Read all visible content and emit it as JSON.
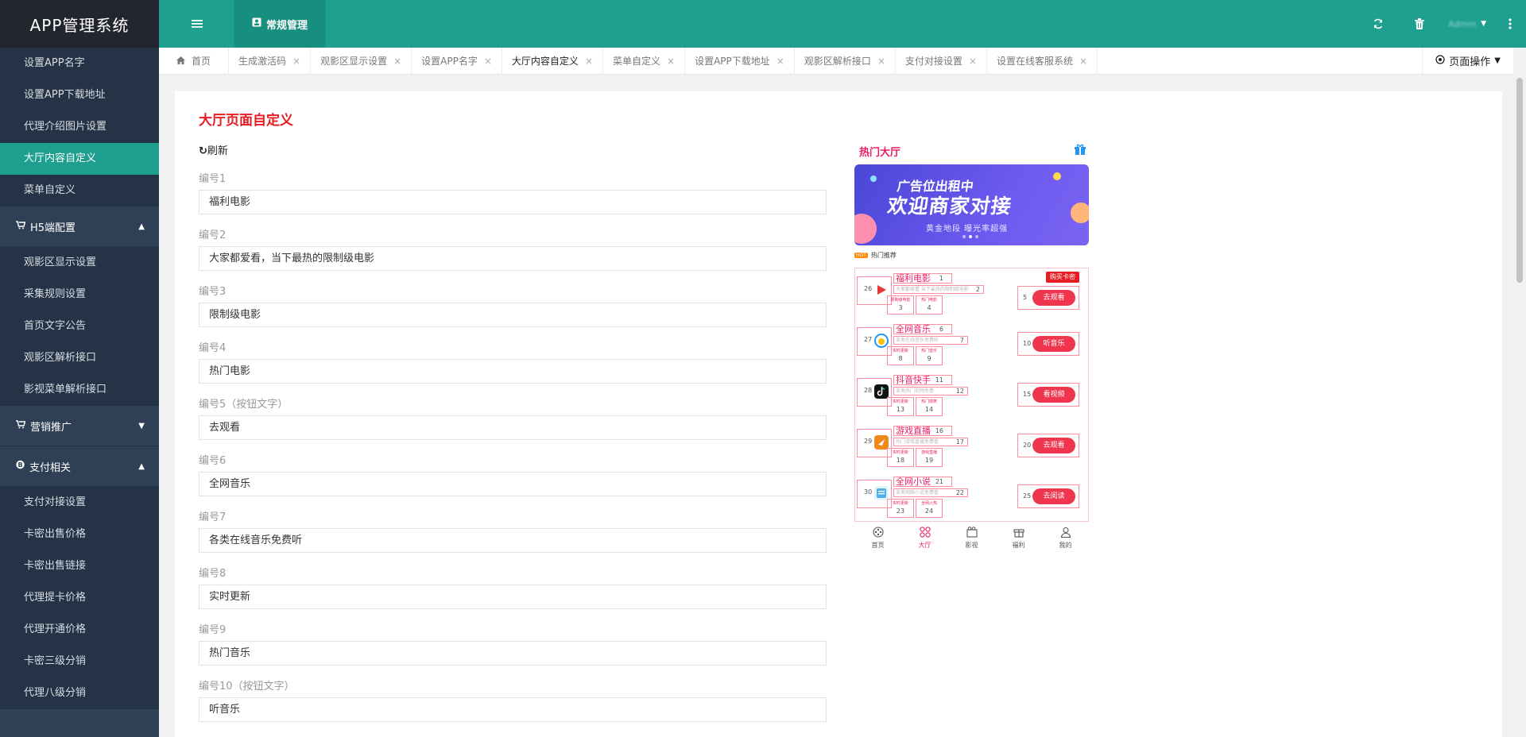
{
  "app": {
    "title": "APP管理系统"
  },
  "sidebar": {
    "items_top": [
      {
        "label": "设置APP名字"
      },
      {
        "label": "设置APP下载地址"
      },
      {
        "label": "代理介绍图片设置"
      },
      {
        "label": "大厅内容自定义",
        "active": true
      },
      {
        "label": "菜单自定义"
      }
    ],
    "group_h5": {
      "label": "H5端配置",
      "icon": "cart-icon"
    },
    "items_h5": [
      {
        "label": "观影区显示设置"
      },
      {
        "label": "采集规则设置"
      },
      {
        "label": "首页文字公告"
      },
      {
        "label": "观影区解析接口"
      },
      {
        "label": "影视菜单解析接口"
      }
    ],
    "group_marketing": {
      "label": "营销推广",
      "icon": "cart-icon"
    },
    "group_pay": {
      "label": "支付相关",
      "icon": "bitcoin-icon"
    },
    "items_pay": [
      {
        "label": "支付对接设置"
      },
      {
        "label": "卡密出售价格"
      },
      {
        "label": "卡密出售链接"
      },
      {
        "label": "代理提卡价格"
      },
      {
        "label": "代理开通价格"
      },
      {
        "label": "卡密三级分销"
      },
      {
        "label": "代理八级分销"
      }
    ]
  },
  "topbar": {
    "module_label": "常规管理",
    "user_name": "Admin"
  },
  "tabs": {
    "home": "首页",
    "items": [
      {
        "label": "生成激活码"
      },
      {
        "label": "观影区显示设置"
      },
      {
        "label": "设置APP名字"
      },
      {
        "label": "大厅内容自定义",
        "active": true
      },
      {
        "label": "菜单自定义"
      },
      {
        "label": "设置APP下载地址"
      },
      {
        "label": "观影区解析接口"
      },
      {
        "label": "支付对接设置"
      },
      {
        "label": "设置在线客服系统"
      }
    ],
    "ops_label": "页面操作"
  },
  "main": {
    "title": "大厅页面自定义",
    "refresh_label": "刷新",
    "fields": [
      {
        "label": "编号1",
        "value": "福利电影"
      },
      {
        "label": "编号2",
        "value": "大家都爱看，当下最热的限制级电影"
      },
      {
        "label": "编号3",
        "value": "限制级电影"
      },
      {
        "label": "编号4",
        "value": "热门电影"
      },
      {
        "label": "编号5（按钮文字）",
        "value": "去观看"
      },
      {
        "label": "编号6",
        "value": "全网音乐"
      },
      {
        "label": "编号7",
        "value": "各类在线音乐免费听"
      },
      {
        "label": "编号8",
        "value": "实时更新"
      },
      {
        "label": "编号9",
        "value": "热门音乐"
      },
      {
        "label": "编号10（按钮文字）",
        "value": "听音乐"
      }
    ]
  },
  "preview": {
    "title": "热门大厅",
    "banner_line1": "广告位出租中",
    "banner_line2": "欢迎商家对接",
    "banner_line3": "黄金地段    曝光率超强",
    "rec_badge": "HOT",
    "rec_label": "热门推荐",
    "buy_card": "购买卡密",
    "rows": [
      {
        "icon_num": "26",
        "name": "福利电影",
        "name_num": "1",
        "desc": "大家都爱看 当下最热的限制级电影",
        "desc_num": "2",
        "tag1": "限制级电影",
        "tag1_num": "3",
        "tag2": "热门电影",
        "tag2_num": "4",
        "btn_num": "5",
        "btn": "去观看",
        "color": "#e53935"
      },
      {
        "icon_num": "27",
        "name": "全网音乐",
        "name_num": "6",
        "desc": "各类在线音乐免费听",
        "desc_num": "7",
        "tag1": "实时更新",
        "tag1_num": "8",
        "tag2": "热门音乐",
        "tag2_num": "9",
        "btn_num": "10",
        "btn": "听音乐",
        "color": "#2196f3"
      },
      {
        "icon_num": "28",
        "name": "抖音快手",
        "name_num": "11",
        "desc": "各类热门视频免费",
        "desc_num": "12",
        "tag1": "实时更新",
        "tag1_num": "13",
        "tag2": "热门搞笑",
        "tag2_num": "14",
        "btn_num": "15",
        "btn": "看视频",
        "color": "#111111"
      },
      {
        "icon_num": "29",
        "name": "游戏直播",
        "name_num": "16",
        "desc": "热门游戏直播免费看",
        "desc_num": "17",
        "tag1": "实时更新",
        "tag1_num": "18",
        "tag2": "游戏直播",
        "tag2_num": "19",
        "btn_num": "20",
        "btn": "去观看",
        "color": "#ef8a1a"
      },
      {
        "icon_num": "30",
        "name": "全网小说",
        "name_num": "21",
        "desc": "各类网络小说免费看",
        "desc_num": "22",
        "tag1": "实时更新",
        "tag1_num": "23",
        "tag2": "全网火热",
        "tag2_num": "24",
        "btn_num": "25",
        "btn": "去阅读",
        "color": "#4fb0e8"
      }
    ],
    "nav": [
      {
        "label": "首页"
      },
      {
        "label": "大厅",
        "active": true
      },
      {
        "label": "影视"
      },
      {
        "label": "福利"
      },
      {
        "label": "我的"
      }
    ]
  },
  "colors": {
    "accent": "#1e9f8f",
    "sidebar": "#2f4056",
    "title_red": "#e51c23",
    "preview_pink": "#e91e63"
  }
}
